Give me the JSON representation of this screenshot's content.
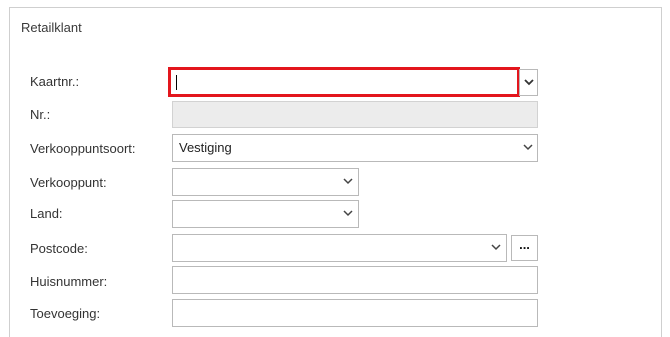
{
  "section": {
    "title": "Retailklant"
  },
  "fields": {
    "kaartnr": {
      "label": "Kaartnr.:",
      "value": ""
    },
    "nr": {
      "label": "Nr.:",
      "value": ""
    },
    "verkooppuntsoort": {
      "label": "Verkooppuntsoort:",
      "value": "Vestiging"
    },
    "verkooppunt": {
      "label": "Verkooppunt:",
      "value": ""
    },
    "land": {
      "label": "Land:",
      "value": ""
    },
    "postcode": {
      "label": "Postcode:",
      "value": "",
      "lookup_label": "..."
    },
    "huisnummer": {
      "label": "Huisnummer:",
      "value": ""
    },
    "toevoeging": {
      "label": "Toevoeging:",
      "value": ""
    }
  },
  "colors": {
    "focus_border": "#e3161d",
    "readonly_bg": "#ececec",
    "border": "#b9b9b9"
  },
  "icons": {
    "dropdown": "chevron-down-icon"
  }
}
